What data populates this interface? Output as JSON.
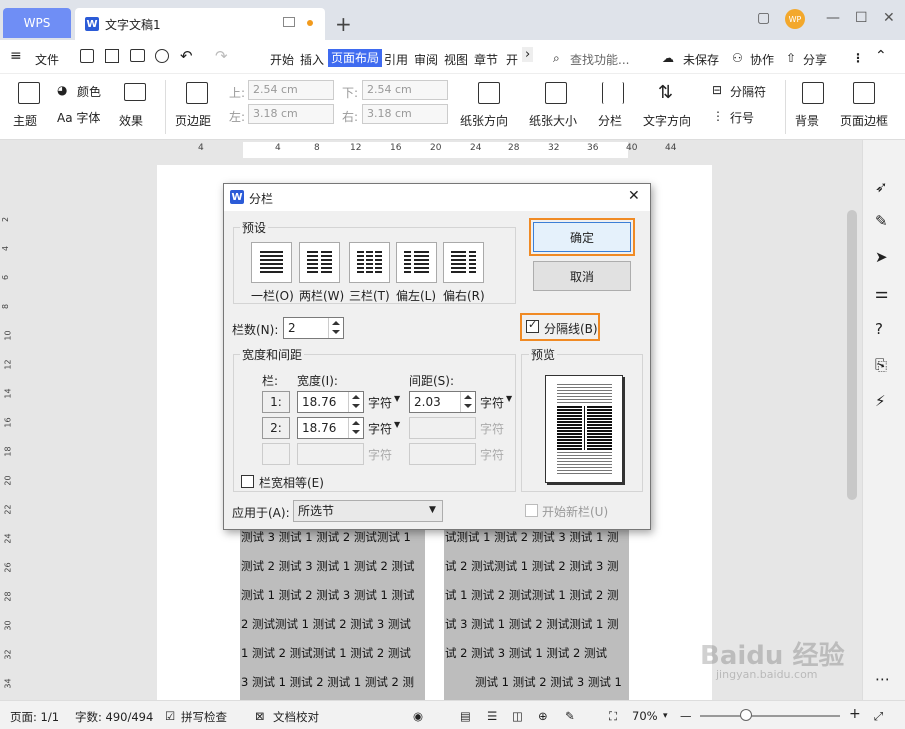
{
  "tabs": {
    "wps": "WPS",
    "doc": "文字文稿1",
    "new": "+"
  },
  "window": {
    "restore": "▢",
    "min": "—",
    "max": "☐",
    "close": "✕",
    "avatar": "WP"
  },
  "menu": {
    "file": "文件",
    "items": [
      "开始",
      "插入",
      "页面布局",
      "引用",
      "审阅",
      "视图",
      "章节",
      "开"
    ],
    "active": "页面布局",
    "search": "查找功能...",
    "unsaved": "未保存",
    "collab": "协作",
    "share": "分享"
  },
  "ribbon": {
    "theme": "主题",
    "color": "颜色",
    "font": "Aa 字体",
    "effect": "效果",
    "margin": "页边距",
    "top_label": "上:",
    "top_val": "2.54 cm",
    "left_label": "左:",
    "left_val": "3.18 cm",
    "bottom_label": "下:",
    "bottom_val": "2.54 cm",
    "right_label": "右:",
    "right_val": "3.18 cm",
    "orientation": "纸张方向",
    "size": "纸张大小",
    "columns": "分栏",
    "direction": "文字方向",
    "separator": "分隔符",
    "line_no": "行号",
    "background": "背景",
    "border": "页面边框"
  },
  "ruler": {
    "h": [
      "4",
      "4",
      "8",
      "12",
      "16",
      "20",
      "24",
      "28",
      "32",
      "36",
      "40",
      "44"
    ],
    "v": [
      "2",
      "4",
      "6",
      "8",
      "10",
      "12",
      "14",
      "16",
      "18",
      "20",
      "22",
      "24",
      "26",
      "28",
      "30",
      "32",
      "34"
    ]
  },
  "document": {
    "left": [
      "测试 3 测试 1 测试 2 测试测试 1",
      "测试 2 测试 3 测试 1 测试 2 测试",
      "测试 1 测试 2 测试 3 测试 1 测试",
      "2 测试测试 1 测试 2 测试 3 测试",
      "1 测试 2 测试测试 1 测试 2 测试",
      "3 测试 1 测试 2 测试 1 测试 2 测"
    ],
    "right": [
      "试测试 1 测试 2 测试 3 测试 1 测",
      "试 2 测试测试 1 测试 2 测试 3 测",
      "试 1 测试 2 测试测试 1 测试 2 测",
      "试 3 测试 1 测试 2 测试测试 1 测",
      "试 2 测试 3 测试 1 测试 2 测试",
      "测试 1 测试 2 测试 3 测试 1"
    ]
  },
  "dialog": {
    "title": "分栏",
    "preset_label": "预设",
    "presets": [
      "一栏(O)",
      "两栏(W)",
      "三栏(T)",
      "偏左(L)",
      "偏右(R)"
    ],
    "ok": "确定",
    "cancel": "取消",
    "num_label": "栏数(N):",
    "num_value": "2",
    "separator_line": "分隔线(B)",
    "separator_checked": true,
    "width_group": "宽度和间距",
    "col_header": "栏:",
    "width_header": "宽度(I):",
    "spacing_header": "间距(S):",
    "rows": [
      {
        "idx": "1:",
        "width": "18.76",
        "wunit": "字符",
        "spacing": "2.03",
        "sunit": "字符"
      },
      {
        "idx": "2:",
        "width": "18.76",
        "wunit": "字符",
        "spacing": "",
        "sunit": "字符"
      },
      {
        "idx": "",
        "width": "",
        "wunit": "字符",
        "spacing": "",
        "sunit": "字符"
      }
    ],
    "equal_width": "栏宽相等(E)",
    "preview_label": "预览",
    "apply_label": "应用于(A):",
    "apply_value": "所选节",
    "new_column": "开始新栏(U)"
  },
  "status": {
    "page": "页面: 1/1",
    "words": "字数: 490/494",
    "spell": "拼写检查",
    "proof": "文档校对",
    "zoom": "70%"
  },
  "colors": {
    "accent": "#3f6bf0",
    "highlight": "#f08a24",
    "wps_tab": "#6f8ef5"
  }
}
